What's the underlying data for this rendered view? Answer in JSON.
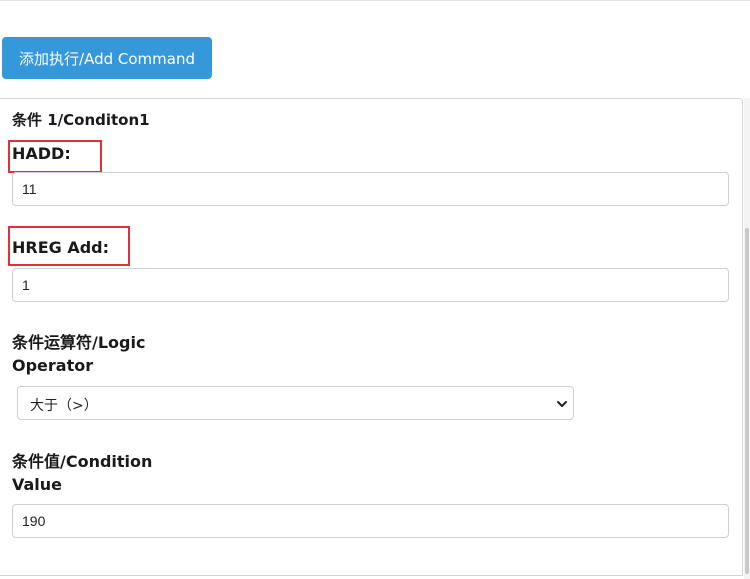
{
  "toolbar": {
    "add_command_label": "添加执行/Add Command"
  },
  "condition": {
    "heading": "条件 1/Conditon1",
    "hadd": {
      "label": "HADD:",
      "value": "11"
    },
    "hreg_add": {
      "label": "HREG Add:",
      "value": "1"
    },
    "logic_operator": {
      "label_line1": "条件运算符/Logic",
      "label_line2": "Operator",
      "selected": "大于（>）"
    },
    "condition_value": {
      "label_line1": "条件值/Condition",
      "label_line2": "Value",
      "value": "190"
    }
  },
  "colors": {
    "button_bg": "#3498db",
    "highlight": "#e0303b"
  },
  "icons": {
    "select_arrow": "chevron-down-icon"
  }
}
